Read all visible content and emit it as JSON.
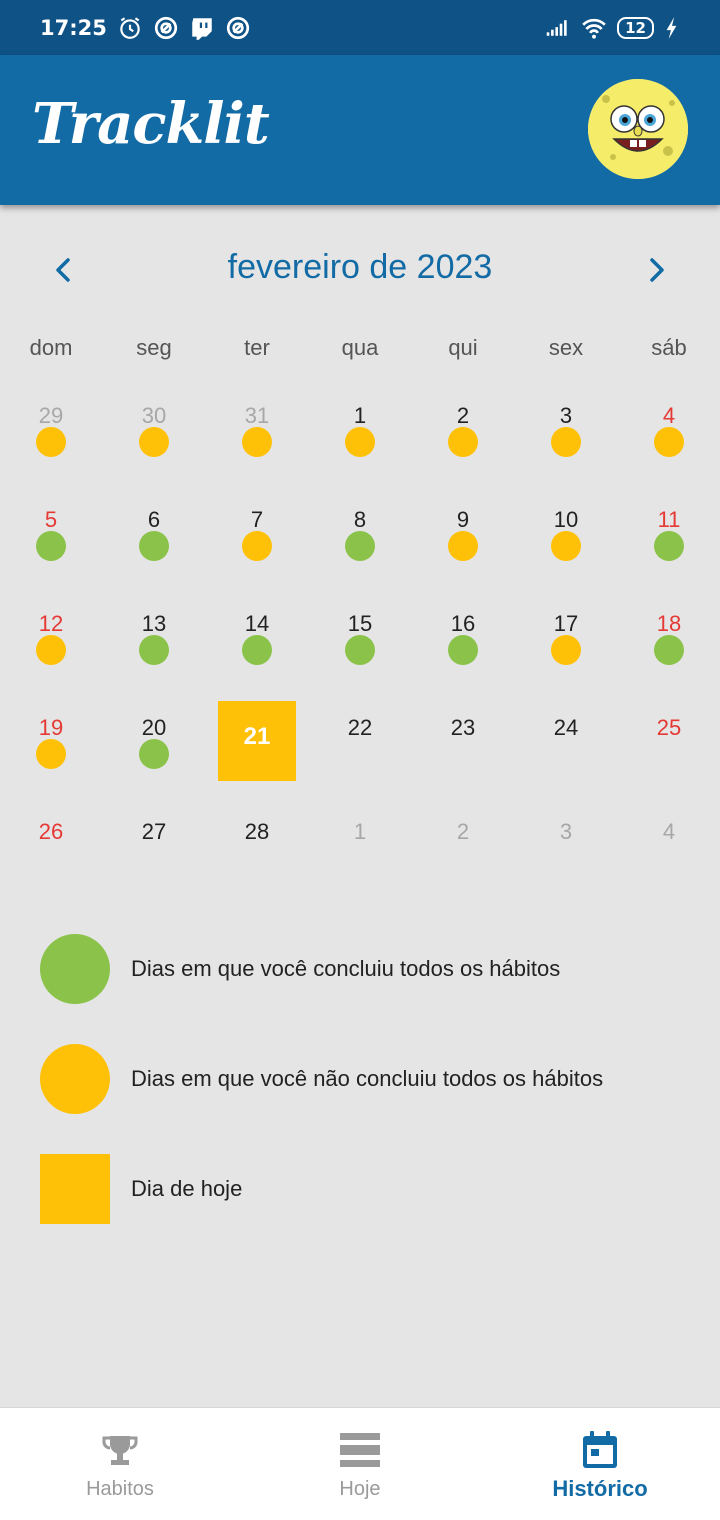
{
  "status_bar": {
    "time": "17:25",
    "battery": "12"
  },
  "app": {
    "title": "Tracklit"
  },
  "calendar": {
    "month_label": "fevereiro de 2023",
    "weekdays": [
      "dom",
      "seg",
      "ter",
      "qua",
      "qui",
      "sex",
      "sáb"
    ],
    "weeks": [
      [
        {
          "day": "29",
          "kind": "other",
          "status": "partial"
        },
        {
          "day": "30",
          "kind": "other",
          "status": "partial"
        },
        {
          "day": "31",
          "kind": "other",
          "status": "partial"
        },
        {
          "day": "1",
          "kind": "normal",
          "status": "partial"
        },
        {
          "day": "2",
          "kind": "normal",
          "status": "partial"
        },
        {
          "day": "3",
          "kind": "normal",
          "status": "partial"
        },
        {
          "day": "4",
          "kind": "weekend",
          "status": "partial"
        }
      ],
      [
        {
          "day": "5",
          "kind": "weekend",
          "status": "done"
        },
        {
          "day": "6",
          "kind": "normal",
          "status": "done"
        },
        {
          "day": "7",
          "kind": "normal",
          "status": "partial"
        },
        {
          "day": "8",
          "kind": "normal",
          "status": "done"
        },
        {
          "day": "9",
          "kind": "normal",
          "status": "partial"
        },
        {
          "day": "10",
          "kind": "normal",
          "status": "partial"
        },
        {
          "day": "11",
          "kind": "weekend",
          "status": "done"
        }
      ],
      [
        {
          "day": "12",
          "kind": "weekend",
          "status": "partial"
        },
        {
          "day": "13",
          "kind": "normal",
          "status": "done"
        },
        {
          "day": "14",
          "kind": "normal",
          "status": "done"
        },
        {
          "day": "15",
          "kind": "normal",
          "status": "done"
        },
        {
          "day": "16",
          "kind": "normal",
          "status": "done"
        },
        {
          "day": "17",
          "kind": "normal",
          "status": "partial"
        },
        {
          "day": "18",
          "kind": "weekend",
          "status": "done"
        }
      ],
      [
        {
          "day": "19",
          "kind": "weekend",
          "status": "partial"
        },
        {
          "day": "20",
          "kind": "normal",
          "status": "done"
        },
        {
          "day": "21",
          "kind": "today",
          "status": "none"
        },
        {
          "day": "22",
          "kind": "normal",
          "status": "none"
        },
        {
          "day": "23",
          "kind": "normal",
          "status": "none"
        },
        {
          "day": "24",
          "kind": "normal",
          "status": "none"
        },
        {
          "day": "25",
          "kind": "weekend",
          "status": "none"
        }
      ],
      [
        {
          "day": "26",
          "kind": "weekend",
          "status": "none"
        },
        {
          "day": "27",
          "kind": "normal",
          "status": "none"
        },
        {
          "day": "28",
          "kind": "normal",
          "status": "none"
        },
        {
          "day": "1",
          "kind": "other",
          "status": "none"
        },
        {
          "day": "2",
          "kind": "other",
          "status": "none"
        },
        {
          "day": "3",
          "kind": "other",
          "status": "none"
        },
        {
          "day": "4",
          "kind": "other",
          "status": "none"
        }
      ]
    ]
  },
  "legend": {
    "done": "Dias em que você concluiu todos os hábitos",
    "partial": "Dias em que você não concluiu todos os hábitos",
    "today": "Dia de hoje"
  },
  "bottom_nav": {
    "tabs": [
      {
        "label": "Habitos",
        "icon": "trophy-icon"
      },
      {
        "label": "Hoje",
        "icon": "list-icon"
      },
      {
        "label": "Histórico",
        "icon": "calendar-icon"
      }
    ]
  },
  "colors": {
    "primary": "#126ba5",
    "status_bar": "#0f5285",
    "done": "#8bc34a",
    "partial": "#ffc107",
    "weekend": "#e53935",
    "background": "#e5e5e5"
  }
}
